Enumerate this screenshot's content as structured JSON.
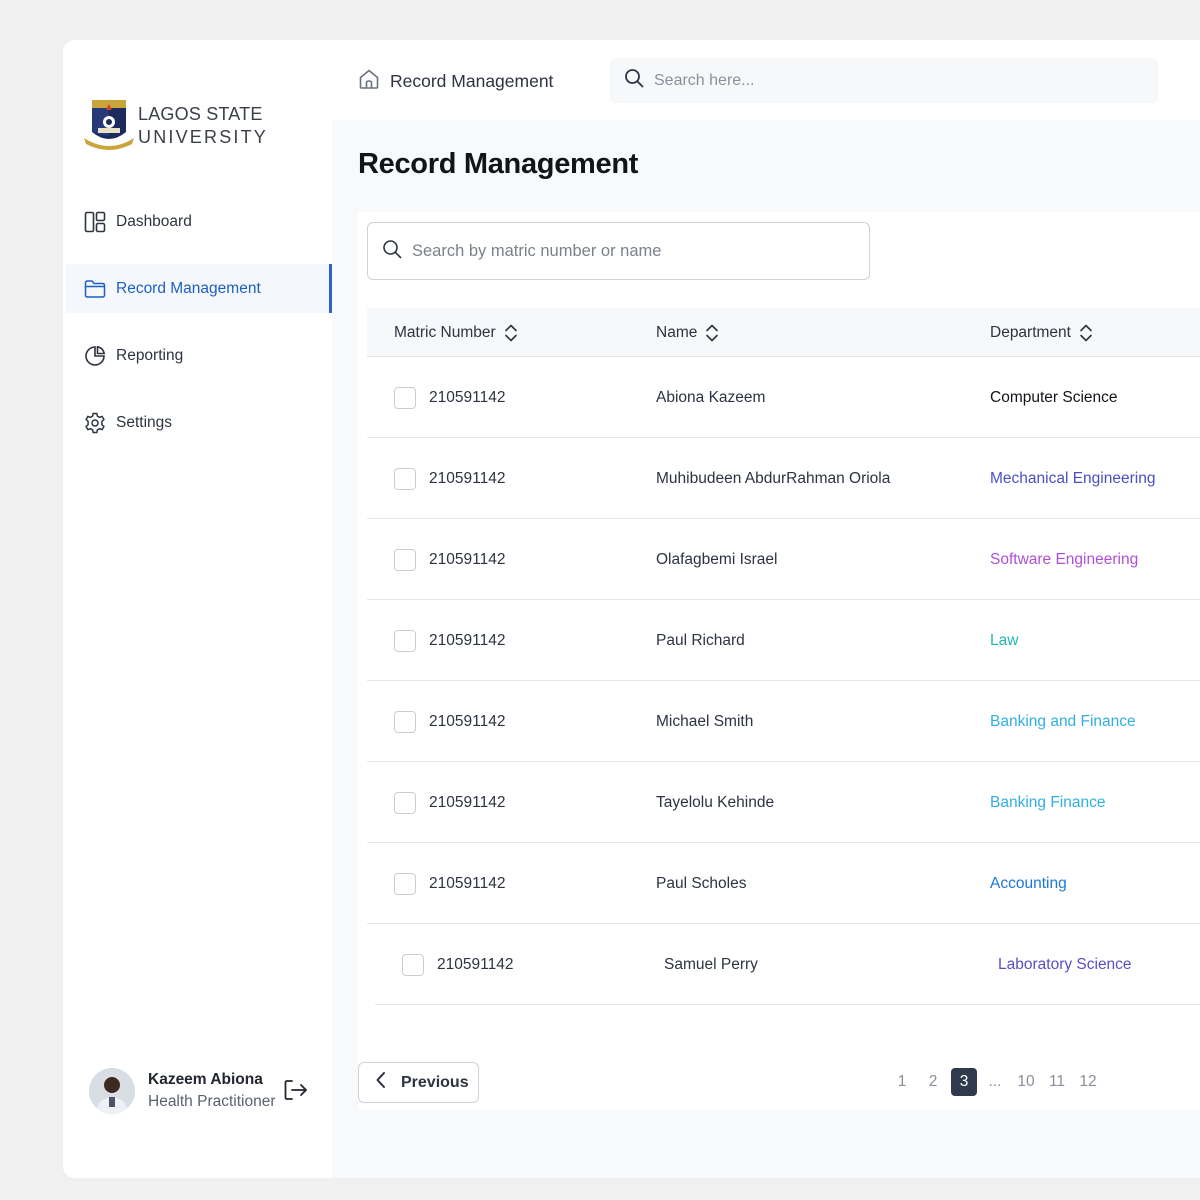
{
  "brand": {
    "line1": "LAGOS STATE",
    "line2": "UNIVERSITY"
  },
  "sidebar": {
    "items": [
      {
        "label": "Dashboard",
        "icon": "dashboard-icon",
        "active": false
      },
      {
        "label": "Record Management",
        "icon": "folder-icon",
        "active": true
      },
      {
        "label": "Reporting",
        "icon": "pie-chart-icon",
        "active": false
      },
      {
        "label": "Settings",
        "icon": "gear-icon",
        "active": false
      }
    ]
  },
  "user": {
    "name": "Kazeem Abiona",
    "role": "Health Practitioner",
    "logout_icon": "logout-icon"
  },
  "header": {
    "breadcrumb": "Record Management",
    "search_placeholder": "Search here..."
  },
  "page": {
    "title": "Record Management"
  },
  "table": {
    "search_placeholder": "Search by matric number or name",
    "columns": [
      "Matric Number",
      "Name",
      "Department"
    ],
    "rows": [
      {
        "matric": "210591142",
        "name": "Abiona Kazeem",
        "department": "Computer Science",
        "dept_color": "#111418"
      },
      {
        "matric": "210591142",
        "name": "Muhibudeen AbdurRahman Oriola",
        "department": "Mechanical Engineering",
        "dept_color": "#4a4fc4"
      },
      {
        "matric": "210591142",
        "name": "Olafagbemi Israel",
        "department": "Software Engineering",
        "dept_color": "#b04fd6"
      },
      {
        "matric": "210591142",
        "name": "Paul Richard",
        "department": "Law",
        "dept_color": "#1fb8b0"
      },
      {
        "matric": "210591142",
        "name": "Michael Smith",
        "department": "Banking and Finance",
        "dept_color": "#2fb0e0"
      },
      {
        "matric": "210591142",
        "name": "Tayelolu Kehinde",
        "department": "Banking Finance",
        "dept_color": "#2fb0e0"
      },
      {
        "matric": "210591142",
        "name": "Paul Scholes",
        "department": "Accounting",
        "dept_color": "#1a78d6"
      },
      {
        "matric": "210591142",
        "name": "Samuel Perry",
        "department": "Laboratory Science",
        "dept_color": "#5a4fc4"
      }
    ]
  },
  "pagination": {
    "prev_label": "Previous",
    "pages": [
      "1",
      "2",
      "3",
      "...",
      "10",
      "11",
      "12"
    ],
    "current": "3"
  }
}
